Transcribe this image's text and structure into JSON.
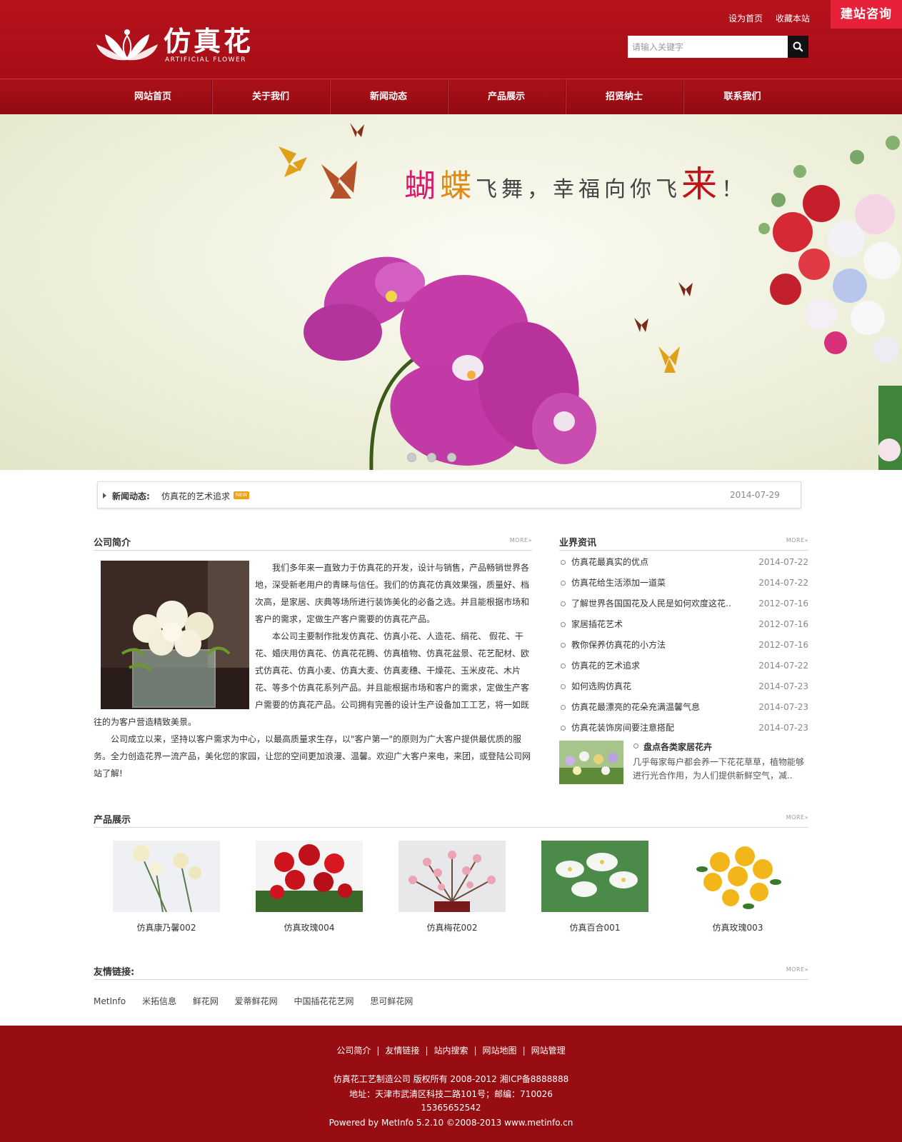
{
  "header": {
    "logo_title": "仿真花",
    "logo_sub": "ARTIFICIAL FLOWER",
    "toplinks": [
      "设为首页",
      "收藏本站"
    ],
    "consult_label": "建站咨询",
    "search_placeholder": "请输入关键字",
    "colors": {
      "brand": "#a80f17",
      "consult": "#e8213a"
    }
  },
  "nav": [
    "网站首页",
    "关于我们",
    "新闻动态",
    "产品展示",
    "招贤纳士",
    "联系我们"
  ],
  "banner": {
    "slogan": {
      "part1": "蝴",
      "part2": "蝶",
      "part3": "飞舞，幸福向你飞",
      "part4": "来",
      "part5": "！"
    },
    "slides": 3,
    "active_slide": 1
  },
  "newsbar": {
    "label": "新闻动态:",
    "title": "仿真花的艺术追求",
    "badge": "NEW",
    "date": "2014-07-29"
  },
  "intro": {
    "title": "公司简介",
    "more": "MORE»",
    "paragraphs": [
      "我们多年来一直致力于仿真花的开发，设计与销售，产品畅销世界各地，深受新老用户的青睐与信任。我们的仿真花仿真效果强，质量好、档次高，是家居、庆典等场所进行装饰美化的必备之选。并且能根据市场和客户的需求，定做生产客户需要的仿真花产品。",
      "本公司主要制作批发仿真花、仿真小花、人造花、绢花、 假花、干花、婚庆用仿真花、仿真花花腾、仿真植物、仿真花盆景、花艺配材、欧式仿真花、仿真小麦、仿真大麦、仿真麦穗、干燥花、玉米皮花、木片花、等多个仿真花系列产品。并且能根据市场和客户的需求，定做生产客户需要的仿真花产品。公司拥有完善的设计生产设备加工工艺，将一如既往的为客户营造精致美景。",
      "公司成立以来，坚持以客户需求为中心，以最高质量求生存，以\"客户第一\"的原则为广大客户提供最优质的服务。全力创造花界一流产品，美化您的家园，让您的空间更加浪漫、温馨。欢迎广大客户来电，来团，或登陆公司网站了解!"
    ]
  },
  "industry": {
    "title": "业界资讯",
    "more": "MORE»",
    "items": [
      {
        "title": "仿真花最真实的优点",
        "date": "2014-07-22"
      },
      {
        "title": "仿真花给生活添加一道菜",
        "date": "2014-07-22"
      },
      {
        "title": "了解世界各国国花及人民是如何欢度这花..",
        "date": "2012-07-16"
      },
      {
        "title": "家居插花艺术",
        "date": "2012-07-16"
      },
      {
        "title": "教你保养仿真花的小方法",
        "date": "2012-07-16"
      },
      {
        "title": "仿真花的艺术追求",
        "date": "2014-07-22"
      },
      {
        "title": "如何选购仿真花",
        "date": "2014-07-23"
      },
      {
        "title": "仿真花最漂亮的花朵充满温馨气息",
        "date": "2014-07-23"
      },
      {
        "title": "仿真花装饰房间要注意搭配",
        "date": "2014-07-23"
      }
    ],
    "feature": {
      "title": "盘点各类家居花卉",
      "desc": "几乎每家每户都会养一下花花草草，植物能够进行光合作用，为人们提供新鲜空气，减.."
    }
  },
  "products": {
    "title": "产品展示",
    "more": "MORE»",
    "items": [
      "仿真康乃馨002",
      "仿真玫瑰004",
      "仿真梅花002",
      "仿真百合001",
      "仿真玫瑰003"
    ]
  },
  "links": {
    "title": "友情链接:",
    "more": "MORE»",
    "items": [
      "MetInfo",
      "米拓信息",
      "鲜花网",
      "爱蒂鲜花网",
      "中国插花花艺网",
      "思可鲜花网"
    ]
  },
  "footer": {
    "nav": [
      "公司简介",
      "友情链接",
      "站内搜索",
      "网站地图",
      "网站管理"
    ],
    "copyright": "仿真花工艺制造公司 版权所有 2008-2012 湘ICP备8888888",
    "address": "地址：天津市武清区科技二路101号；邮编：710026",
    "phone": "15365652542",
    "powered": "Powered by MetInfo 5.2.10 ©2008-2013 www.metinfo.cn"
  }
}
